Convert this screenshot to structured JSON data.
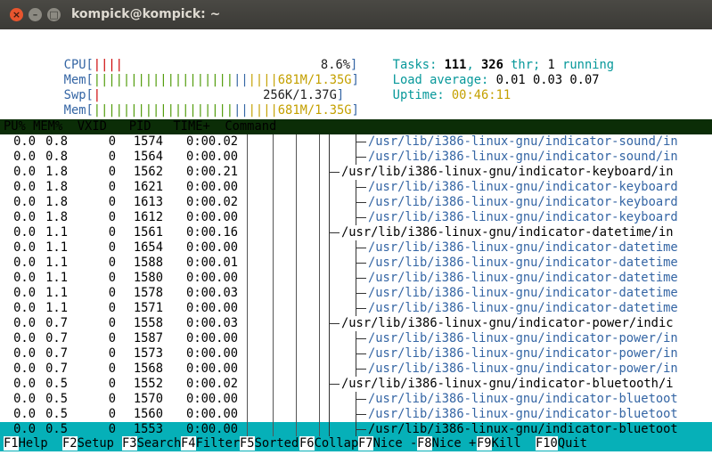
{
  "window": {
    "title": "kompick@kompick: ~",
    "close": "×",
    "minimize": "–",
    "maximize": "□"
  },
  "meters": {
    "cpu": {
      "label": "CPU[",
      "bars": "||||",
      "value": "8.6%",
      "end": "]"
    },
    "mem": {
      "label": "Mem[",
      "bars_green": "|||||||||||||||||||",
      "bars_blue": "||",
      "bars_yellow": "||||",
      "value": "681M/1.35G",
      "end": "]"
    },
    "swp": {
      "label": "Swp[",
      "bars": "|",
      "value": "256K/1.37G",
      "end": "]"
    },
    "mem2": {
      "label": "Mem[",
      "bars_green": "|||||||||||||||||||",
      "bars_blue": "||",
      "bars_yellow": "||||",
      "value": "681M/1.35G",
      "end": "]"
    }
  },
  "stats": {
    "tasks_label": "Tasks: ",
    "tasks": "111",
    "sep1": ", ",
    "threads": "326",
    "thr_label": " thr; ",
    "running": "1",
    "running_label": " running",
    "load_label": "Load average: ",
    "load1": "0.01",
    "load5": "0.03",
    "load15": "0.07",
    "uptime_label": "Uptime: ",
    "uptime": "00:46:11"
  },
  "columns": {
    "header": "PU% MEM%  VXID   PID   TIME+  Command"
  },
  "processes": [
    {
      "cpu": "0.0",
      "mem": "0.8",
      "vxid": "0",
      "pid": "1574",
      "time": "0:00.02",
      "cmd": "/usr/lib/i386-linux-gnu/indicator-sound/in",
      "child": true
    },
    {
      "cpu": "0.0",
      "mem": "0.8",
      "vxid": "0",
      "pid": "1564",
      "time": "0:00.00",
      "cmd": "/usr/lib/i386-linux-gnu/indicator-sound/in",
      "child": true
    },
    {
      "cpu": "0.0",
      "mem": "1.8",
      "vxid": "0",
      "pid": "1562",
      "time": "0:00.21",
      "cmd": "/usr/lib/i386-linux-gnu/indicator-keyboard/in",
      "child": false
    },
    {
      "cpu": "0.0",
      "mem": "1.8",
      "vxid": "0",
      "pid": "1621",
      "time": "0:00.00",
      "cmd": "/usr/lib/i386-linux-gnu/indicator-keyboard",
      "child": true
    },
    {
      "cpu": "0.0",
      "mem": "1.8",
      "vxid": "0",
      "pid": "1613",
      "time": "0:00.02",
      "cmd": "/usr/lib/i386-linux-gnu/indicator-keyboard",
      "child": true
    },
    {
      "cpu": "0.0",
      "mem": "1.8",
      "vxid": "0",
      "pid": "1612",
      "time": "0:00.00",
      "cmd": "/usr/lib/i386-linux-gnu/indicator-keyboard",
      "child": true
    },
    {
      "cpu": "0.0",
      "mem": "1.1",
      "vxid": "0",
      "pid": "1561",
      "time": "0:00.16",
      "cmd": "/usr/lib/i386-linux-gnu/indicator-datetime/in",
      "child": false
    },
    {
      "cpu": "0.0",
      "mem": "1.1",
      "vxid": "0",
      "pid": "1654",
      "time": "0:00.00",
      "cmd": "/usr/lib/i386-linux-gnu/indicator-datetime",
      "child": true
    },
    {
      "cpu": "0.0",
      "mem": "1.1",
      "vxid": "0",
      "pid": "1588",
      "time": "0:00.01",
      "cmd": "/usr/lib/i386-linux-gnu/indicator-datetime",
      "child": true
    },
    {
      "cpu": "0.0",
      "mem": "1.1",
      "vxid": "0",
      "pid": "1580",
      "time": "0:00.00",
      "cmd": "/usr/lib/i386-linux-gnu/indicator-datetime",
      "child": true
    },
    {
      "cpu": "0.0",
      "mem": "1.1",
      "vxid": "0",
      "pid": "1578",
      "time": "0:00.03",
      "cmd": "/usr/lib/i386-linux-gnu/indicator-datetime",
      "child": true
    },
    {
      "cpu": "0.0",
      "mem": "1.1",
      "vxid": "0",
      "pid": "1571",
      "time": "0:00.00",
      "cmd": "/usr/lib/i386-linux-gnu/indicator-datetime",
      "child": true
    },
    {
      "cpu": "0.0",
      "mem": "0.7",
      "vxid": "0",
      "pid": "1558",
      "time": "0:00.03",
      "cmd": "/usr/lib/i386-linux-gnu/indicator-power/indic",
      "child": false
    },
    {
      "cpu": "0.0",
      "mem": "0.7",
      "vxid": "0",
      "pid": "1587",
      "time": "0:00.00",
      "cmd": "/usr/lib/i386-linux-gnu/indicator-power/in",
      "child": true
    },
    {
      "cpu": "0.0",
      "mem": "0.7",
      "vxid": "0",
      "pid": "1573",
      "time": "0:00.00",
      "cmd": "/usr/lib/i386-linux-gnu/indicator-power/in",
      "child": true
    },
    {
      "cpu": "0.0",
      "mem": "0.7",
      "vxid": "0",
      "pid": "1568",
      "time": "0:00.00",
      "cmd": "/usr/lib/i386-linux-gnu/indicator-power/in",
      "child": true
    },
    {
      "cpu": "0.0",
      "mem": "0.5",
      "vxid": "0",
      "pid": "1552",
      "time": "0:00.02",
      "cmd": "/usr/lib/i386-linux-gnu/indicator-bluetooth/i",
      "child": false
    },
    {
      "cpu": "0.0",
      "mem": "0.5",
      "vxid": "0",
      "pid": "1570",
      "time": "0:00.00",
      "cmd": "/usr/lib/i386-linux-gnu/indicator-bluetoot",
      "child": true
    },
    {
      "cpu": "0.0",
      "mem": "0.5",
      "vxid": "0",
      "pid": "1560",
      "time": "0:00.00",
      "cmd": "/usr/lib/i386-linux-gnu/indicator-bluetoot",
      "child": true
    },
    {
      "cpu": "0.0",
      "mem": "0.5",
      "vxid": "0",
      "pid": "1553",
      "time": "0:00.00",
      "cmd": "/usr/lib/i386-linux-gnu/indicator-bluetoot",
      "child": true,
      "selected": true
    }
  ],
  "footer": [
    {
      "key": "F1",
      "label": "Help  "
    },
    {
      "key": "F2",
      "label": "Setup "
    },
    {
      "key": "F3",
      "label": "Search"
    },
    {
      "key": "F4",
      "label": "Filter"
    },
    {
      "key": "F5",
      "label": "Sorted"
    },
    {
      "key": "F6",
      "label": "Collap"
    },
    {
      "key": "F7",
      "label": "Nice -"
    },
    {
      "key": "F8",
      "label": "Nice +"
    },
    {
      "key": "F9",
      "label": "Kill  "
    },
    {
      "key": "F10",
      "label": "Quit"
    }
  ],
  "colors": {
    "header_bg": "#0b2d07",
    "selected_bg": "#06b0b8",
    "blue_text": "#3465a4",
    "cyan_text": "#06989a",
    "yellow_text": "#c4a000"
  }
}
